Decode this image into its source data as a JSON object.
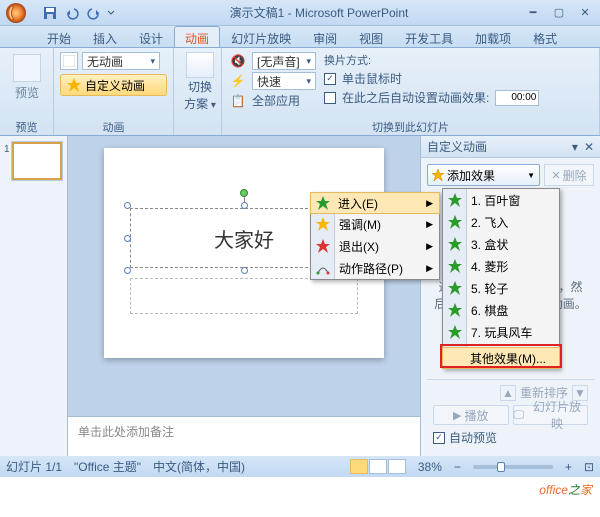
{
  "window": {
    "title": "演示文稿1 - Microsoft PowerPoint"
  },
  "tabs": [
    "开始",
    "插入",
    "设计",
    "动画",
    "幻灯片放映",
    "审阅",
    "视图",
    "开发工具",
    "加载项",
    "格式"
  ],
  "active_tab_index": 3,
  "ribbon": {
    "preview": {
      "label": "预览",
      "group": "预览"
    },
    "animation": {
      "none": "无动画",
      "custom_btn": "自定义动画",
      "group": "动画"
    },
    "switch": {
      "label1": "切换",
      "label2": "方案"
    },
    "transition": {
      "sound": "[无声音]",
      "speed": "快速",
      "apply_all": "全部应用",
      "heading": "换片方式:",
      "on_click": "单击鼠标时",
      "auto_after": "在此之后自动设置动画效果:",
      "time": "00:00",
      "group": "切换到此幻灯片"
    }
  },
  "slide": {
    "title_text": "大家好"
  },
  "notes_placeholder": "单击此处添加备注",
  "task_pane": {
    "title": "自定义动画",
    "add_effect": "添加效果",
    "remove": "删除",
    "hint": "选中幻灯片的某个元素，然后单击\"添加效果\"添加动画。",
    "reorder": "重新排序",
    "play": "播放",
    "slideshow": "幻灯片放映",
    "auto_preview": "自动预览"
  },
  "menu1": [
    {
      "label": "进入(E)",
      "icon": "green-star"
    },
    {
      "label": "强调(M)",
      "icon": "yellow-star"
    },
    {
      "label": "退出(X)",
      "icon": "red-star"
    },
    {
      "label": "动作路径(P)",
      "icon": "path"
    }
  ],
  "menu2": {
    "items": [
      "1. 百叶窗",
      "2. 飞入",
      "3. 盒状",
      "4. 菱形",
      "5. 轮子",
      "6. 棋盘",
      "7. 玩具风车"
    ],
    "more": "其他效果(M)..."
  },
  "statusbar": {
    "slide": "幻灯片 1/1",
    "theme": "\"Office 主题\"",
    "lang": "中文(简体，中国)",
    "zoom": "38%"
  },
  "watermark": {
    "t1": "office",
    "t2": "之",
    "t3": "家"
  }
}
